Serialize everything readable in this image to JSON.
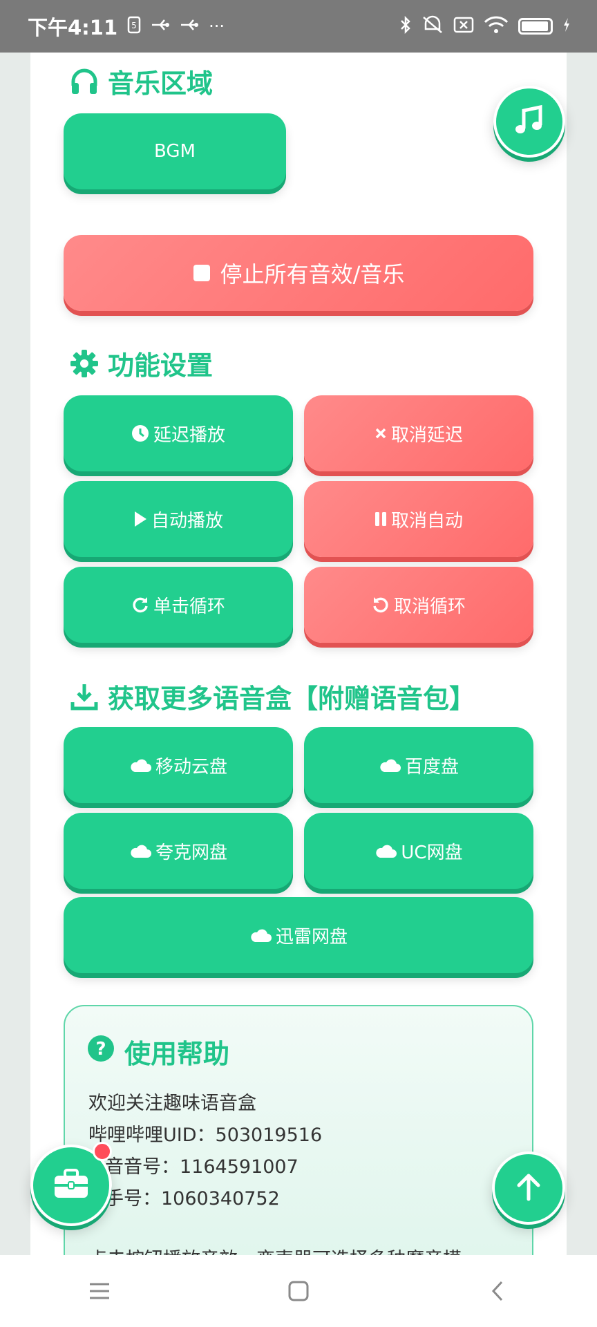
{
  "status_bar": {
    "time": "下午4:11",
    "dots": "···"
  },
  "sections": {
    "music": {
      "title": "音乐区域"
    },
    "settings": {
      "title": "功能设置"
    },
    "download": {
      "title": "获取更多语音盒【附赠语音包】"
    }
  },
  "music": {
    "bgm_label": "BGM",
    "stop_all_label": "停止所有音效/音乐"
  },
  "settings": {
    "delay_play": "延迟播放",
    "cancel_delay": "取消延迟",
    "auto_play": "自动播放",
    "cancel_auto": "取消自动",
    "single_loop": "单击循环",
    "cancel_loop": "取消循环"
  },
  "download": {
    "mobile_cloud": "移动云盘",
    "baidu": "百度盘",
    "quark": "夸克网盘",
    "uc": "UC网盘",
    "xunlei": "迅雷网盘"
  },
  "help": {
    "title": "使用帮助",
    "line1": "欢迎关注趣味语音盒",
    "line2": "哔哩哔哩UID：503019516",
    "line3": "音音号：1164591007",
    "line4": "手号：1060340752",
    "line5": "点击按钮播放音效，变声器可选择多种魔音模"
  },
  "colors": {
    "green": "#22cf8f",
    "red": "#ff6b6b",
    "title_green": "#20c48a"
  }
}
